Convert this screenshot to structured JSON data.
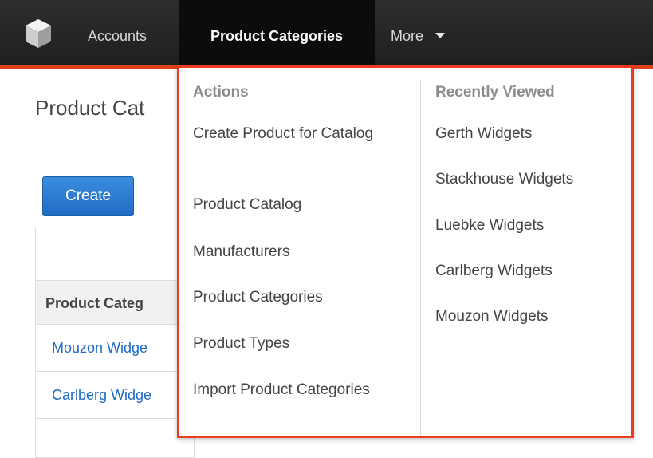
{
  "nav": {
    "logo_icon": "cube-logo-icon",
    "items": [
      {
        "label": "Accounts"
      },
      {
        "label": "Product Categories"
      },
      {
        "label": "More"
      }
    ],
    "accent_color": "#e0411f"
  },
  "page": {
    "title": "Product Cat",
    "create_label": "Create",
    "table": {
      "header": "Product Categ",
      "rows": [
        "Mouzon Widge",
        "Carlberg Widge"
      ]
    }
  },
  "dropdown": {
    "highlight_color": "#ee3b1f",
    "actions": {
      "heading": "Actions",
      "items": [
        "Create Product for Catalog",
        "Product Catalog",
        "Manufacturers",
        "Product Categories",
        "Product Types",
        "Import Product Categories"
      ]
    },
    "recent": {
      "heading": "Recently Viewed",
      "items": [
        "Gerth Widgets",
        "Stackhouse Widgets",
        "Luebke Widgets",
        "Carlberg Widgets",
        "Mouzon Widgets"
      ]
    }
  }
}
